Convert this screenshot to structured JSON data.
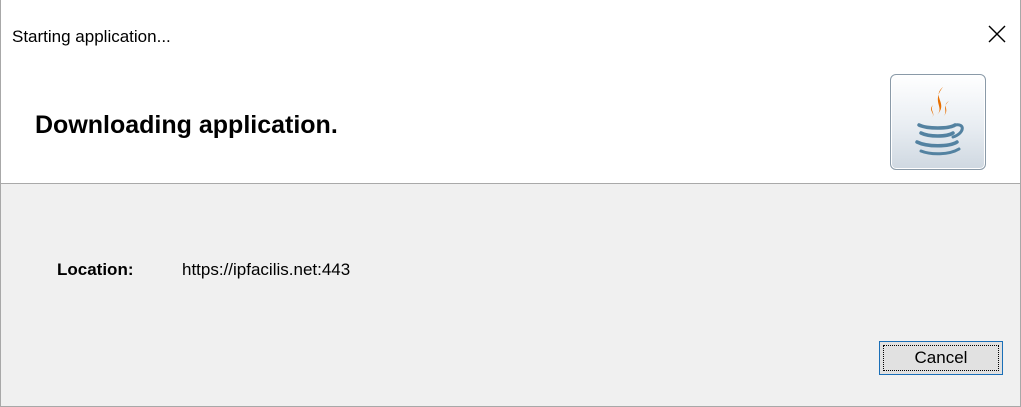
{
  "window": {
    "title": "Starting application...",
    "close_icon": "close-icon"
  },
  "header": {
    "title": "Downloading application.",
    "logo_icon": "java-coffee-cup-icon",
    "logo_colors": {
      "steam": "#e76f00",
      "cup": "#5382a1"
    }
  },
  "body": {
    "location_label": "Location:",
    "location_value": "https://ipfacilis.net:443"
  },
  "buttons": {
    "cancel_label": "Cancel"
  },
  "colors": {
    "accent_focus_border": "#1a6fb8",
    "dialog_background": "#f0f0f0",
    "header_background": "#ffffff"
  }
}
